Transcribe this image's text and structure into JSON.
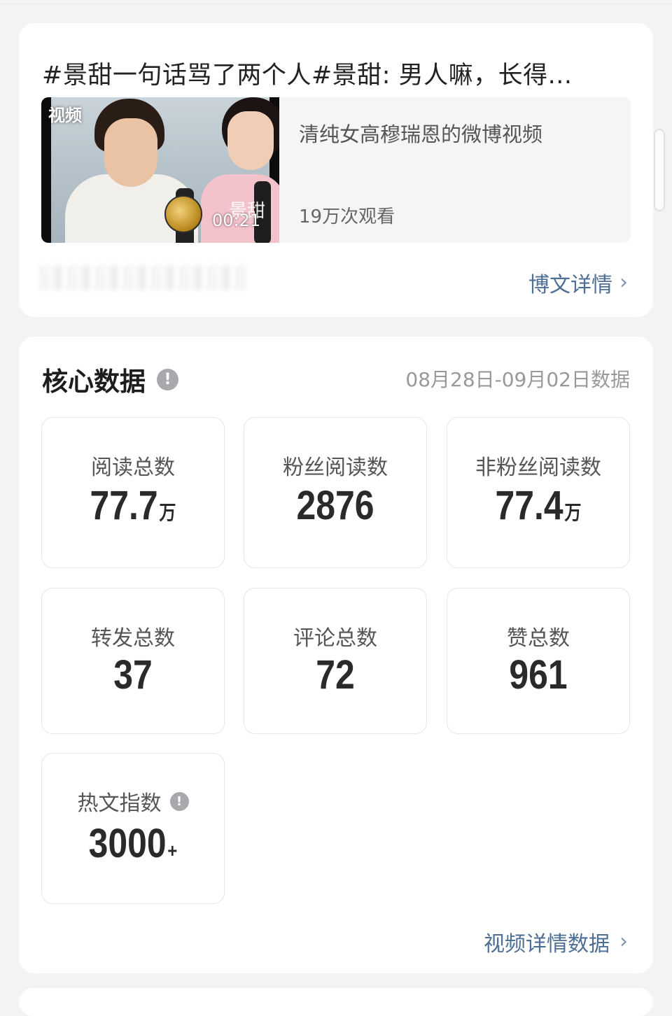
{
  "post": {
    "title": "#景甜一句话骂了两个人#景甜: 男人嘛，长得...",
    "video_badge": "视频",
    "duration": "00:21",
    "caption_overlay": "景甜",
    "video_title": "清纯女高穆瑞恩的微博视频",
    "views": "19万次观看",
    "detail_link": "博文详情"
  },
  "core": {
    "title": "核心数据",
    "date_range": "08月28日-09月02日数据",
    "stats": [
      {
        "label": "阅读总数",
        "value": "77.7",
        "unit": "万"
      },
      {
        "label": "粉丝阅读数",
        "value": "2876",
        "unit": ""
      },
      {
        "label": "非粉丝阅读数",
        "value": "77.4",
        "unit": "万"
      },
      {
        "label": "转发总数",
        "value": "37",
        "unit": ""
      },
      {
        "label": "评论总数",
        "value": "72",
        "unit": ""
      },
      {
        "label": "赞总数",
        "value": "961",
        "unit": ""
      },
      {
        "label": "热文指数",
        "value": "3000",
        "unit": "+"
      }
    ],
    "video_detail_link": "视频详情数据"
  },
  "icons": {
    "info": "info-icon",
    "chevron": "chevron-right-icon"
  }
}
